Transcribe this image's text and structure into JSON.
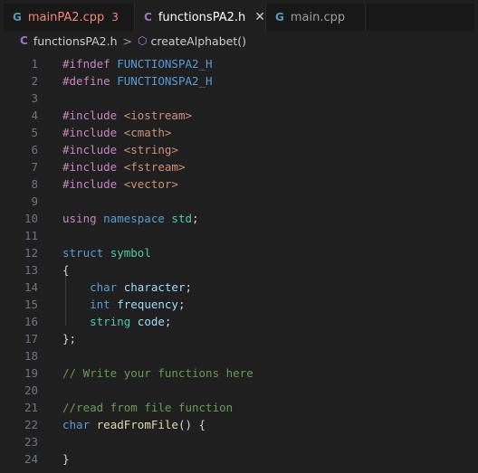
{
  "tabs": [
    {
      "icon": "G",
      "label": "mainPA2.cpp",
      "problems": "3"
    },
    {
      "icon": "C",
      "label": "functionsPA2.h",
      "close": "✕"
    },
    {
      "icon": "G",
      "label": "main.cpp"
    }
  ],
  "breadcrumb": {
    "file_icon": "C",
    "file": "functionsPA2.h",
    "separator": ">",
    "symbol_icon": "⬡",
    "symbol": "createAlphabet()"
  },
  "lines": [
    {
      "n": "1",
      "segs": [
        {
          "t": "#ifndef ",
          "c": "pp"
        },
        {
          "t": "FUNCTIONSPA2_H",
          "c": "mac"
        }
      ]
    },
    {
      "n": "2",
      "segs": [
        {
          "t": "#define ",
          "c": "pp"
        },
        {
          "t": "FUNCTIONSPA2_H",
          "c": "mac"
        }
      ]
    },
    {
      "n": "3",
      "segs": []
    },
    {
      "n": "4",
      "segs": [
        {
          "t": "#include ",
          "c": "pp"
        },
        {
          "t": "<iostream>",
          "c": "str"
        }
      ]
    },
    {
      "n": "5",
      "segs": [
        {
          "t": "#include ",
          "c": "pp"
        },
        {
          "t": "<cmath>",
          "c": "str"
        }
      ]
    },
    {
      "n": "6",
      "segs": [
        {
          "t": "#include ",
          "c": "pp"
        },
        {
          "t": "<string>",
          "c": "str"
        }
      ]
    },
    {
      "n": "7",
      "segs": [
        {
          "t": "#include ",
          "c": "pp"
        },
        {
          "t": "<fstream>",
          "c": "str"
        }
      ]
    },
    {
      "n": "8",
      "segs": [
        {
          "t": "#include ",
          "c": "pp"
        },
        {
          "t": "<vector>",
          "c": "str"
        }
      ]
    },
    {
      "n": "9",
      "segs": []
    },
    {
      "n": "10",
      "segs": [
        {
          "t": "using ",
          "c": "pp"
        },
        {
          "t": "namespace ",
          "c": "kw"
        },
        {
          "t": "std",
          "c": "ty"
        },
        {
          "t": ";",
          "c": "pl"
        }
      ]
    },
    {
      "n": "11",
      "segs": []
    },
    {
      "n": "12",
      "segs": [
        {
          "t": "struct ",
          "c": "kw"
        },
        {
          "t": "symbol",
          "c": "ty"
        }
      ]
    },
    {
      "n": "13",
      "segs": [
        {
          "t": "{",
          "c": "pl"
        }
      ]
    },
    {
      "n": "14",
      "segs": [
        {
          "t": "    char ",
          "c": "kw"
        },
        {
          "t": "character",
          "c": "var"
        },
        {
          "t": ";",
          "c": "pl"
        }
      ]
    },
    {
      "n": "15",
      "segs": [
        {
          "t": "    int ",
          "c": "kw"
        },
        {
          "t": "frequency",
          "c": "var"
        },
        {
          "t": ";",
          "c": "pl"
        }
      ]
    },
    {
      "n": "16",
      "segs": [
        {
          "t": "    string ",
          "c": "ty"
        },
        {
          "t": "code",
          "c": "var"
        },
        {
          "t": ";",
          "c": "pl"
        }
      ]
    },
    {
      "n": "17",
      "segs": [
        {
          "t": "};",
          "c": "pl"
        }
      ]
    },
    {
      "n": "18",
      "segs": []
    },
    {
      "n": "19",
      "segs": [
        {
          "t": "// Write your functions here",
          "c": "cm"
        }
      ]
    },
    {
      "n": "20",
      "segs": []
    },
    {
      "n": "21",
      "segs": [
        {
          "t": "//read from file function",
          "c": "cm"
        }
      ]
    },
    {
      "n": "22",
      "segs": [
        {
          "t": "char ",
          "c": "kw"
        },
        {
          "t": "readFromFile",
          "c": "fn"
        },
        {
          "t": "() {",
          "c": "pl"
        }
      ]
    },
    {
      "n": "23",
      "segs": []
    },
    {
      "n": "24",
      "segs": [
        {
          "t": "}",
          "c": "pl"
        }
      ]
    }
  ],
  "colors": {
    "background": "#1f1f1f",
    "tabbar": "#181818",
    "error": "#f48771",
    "keyword": "#569cd6",
    "preprocessor": "#c586c0",
    "string": "#ce9178",
    "type": "#4ec9b0",
    "variable": "#9cdcfe",
    "function": "#dcdcaa",
    "comment": "#6a9955"
  }
}
